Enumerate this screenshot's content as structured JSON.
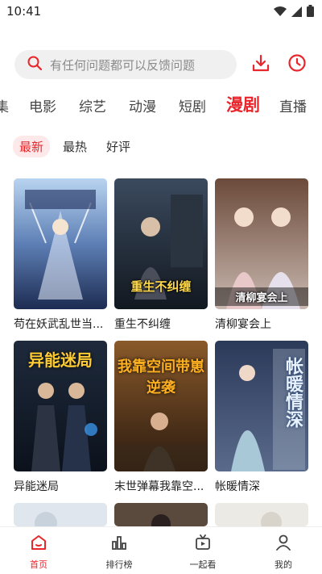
{
  "status_bar": {
    "time": "10:41"
  },
  "search": {
    "placeholder": "有任何问题都可以反馈问题"
  },
  "categories": [
    "集",
    "电影",
    "综艺",
    "动漫",
    "短剧",
    "漫剧",
    "直播"
  ],
  "active_category": "漫剧",
  "filters": [
    "最新",
    "最热",
    "好评"
  ],
  "active_filter": "最新",
  "cards": [
    {
      "title": "苟在妖武乱世当...",
      "poster_text": ""
    },
    {
      "title": "重生不纠缠",
      "poster_text": "重生不纠缠"
    },
    {
      "title": "清柳宴会上",
      "poster_text": "清柳宴会上"
    },
    {
      "title": "异能迷局",
      "poster_text": "异能迷局"
    },
    {
      "title": "末世弹幕我靠空...",
      "poster_text": "我靠空间带崽逆袭"
    },
    {
      "title": "帐暖情深",
      "poster_text": "帐暖情深"
    }
  ],
  "bottom_nav": {
    "items": [
      "首页",
      "排行榜",
      "一起看",
      "我的"
    ],
    "active": "首页"
  },
  "colors": {
    "accent": "#e8262b",
    "search_bg": "#f0f0f0"
  }
}
